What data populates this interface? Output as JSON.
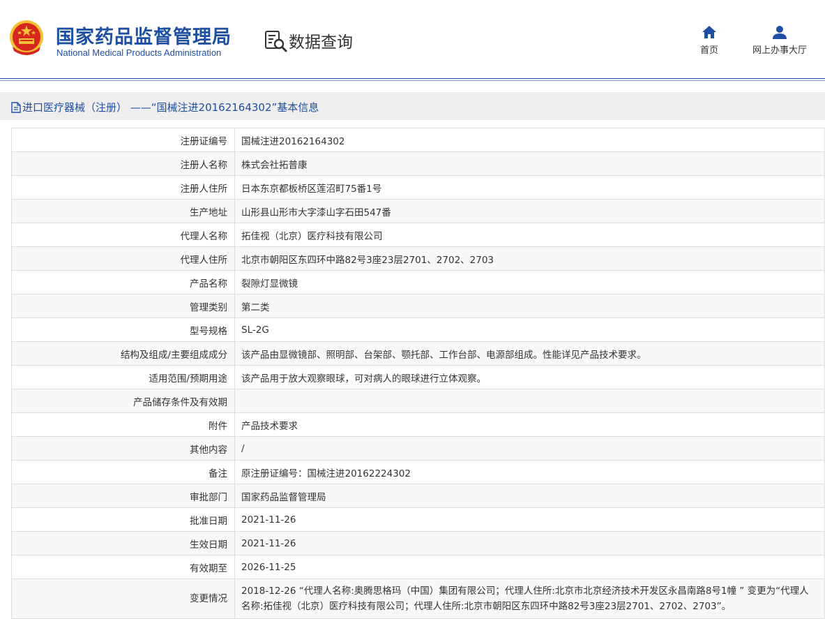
{
  "header": {
    "brand_cn": "国家药品监督管理局",
    "brand_en": "National Medical Products Administration",
    "data_query": "数据查询",
    "nav": [
      {
        "label": "首页",
        "icon": "home-icon"
      },
      {
        "label": "网上办事大厅",
        "icon": "user-icon"
      }
    ],
    "colors": {
      "brand": "#1f4fa0",
      "emblem_red": "#d7261d",
      "emblem_gold": "#f5c033"
    }
  },
  "breadcrumb": {
    "text": "进口医疗器械（注册） ——“国械注进20162164302”基本信息",
    "icon": "document-icon"
  },
  "rows": [
    {
      "label": "注册证编号",
      "value": "国械注进20162164302"
    },
    {
      "label": "注册人名称",
      "value": "株式会社拓普康"
    },
    {
      "label": "注册人住所",
      "value": "日本东京都板桥区莲沼町75番1号"
    },
    {
      "label": "生产地址",
      "value": "山形县山形市大字漆山字石田547番"
    },
    {
      "label": "代理人名称",
      "value": "拓佳视（北京）医疗科技有限公司"
    },
    {
      "label": "代理人住所",
      "value": "北京市朝阳区东四环中路82号3座23层2701、2702、2703"
    },
    {
      "label": "产品名称",
      "value": "裂隙灯显微镜"
    },
    {
      "label": "管理类别",
      "value": "第二类"
    },
    {
      "label": "型号规格",
      "value": "SL-2G"
    },
    {
      "label": "结构及组成/主要组成成分",
      "value": "该产品由显微镜部、照明部、台架部、颚托部、工作台部、电源部组成。性能详见产品技术要求。"
    },
    {
      "label": "适用范围/预期用途",
      "value": "该产品用于放大观察眼球，可对病人的眼球进行立体观察。"
    },
    {
      "label": "产品储存条件及有效期",
      "value": ""
    },
    {
      "label": "附件",
      "value": "产品技术要求"
    },
    {
      "label": "其他内容",
      "value": "/"
    },
    {
      "label": "备注",
      "value": "原注册证编号：国械注进20162224302"
    },
    {
      "label": "审批部门",
      "value": "国家药品监督管理局"
    },
    {
      "label": "批准日期",
      "value": "2021-11-26"
    },
    {
      "label": "生效日期",
      "value": "2021-11-26"
    },
    {
      "label": "有效期至",
      "value": "2026-11-25"
    },
    {
      "label": "变更情况",
      "value": "2018-12-26 “代理人名称:奥腾思格玛（中国）集团有限公司；代理人住所:北京市北京经济技术开发区永昌南路8号1幢 ” 变更为“代理人名称:拓佳视（北京）医疗科技有限公司；代理人住所:北京市朝阳区东四环中路82号3座23层2701、2702、2703”。"
    }
  ]
}
